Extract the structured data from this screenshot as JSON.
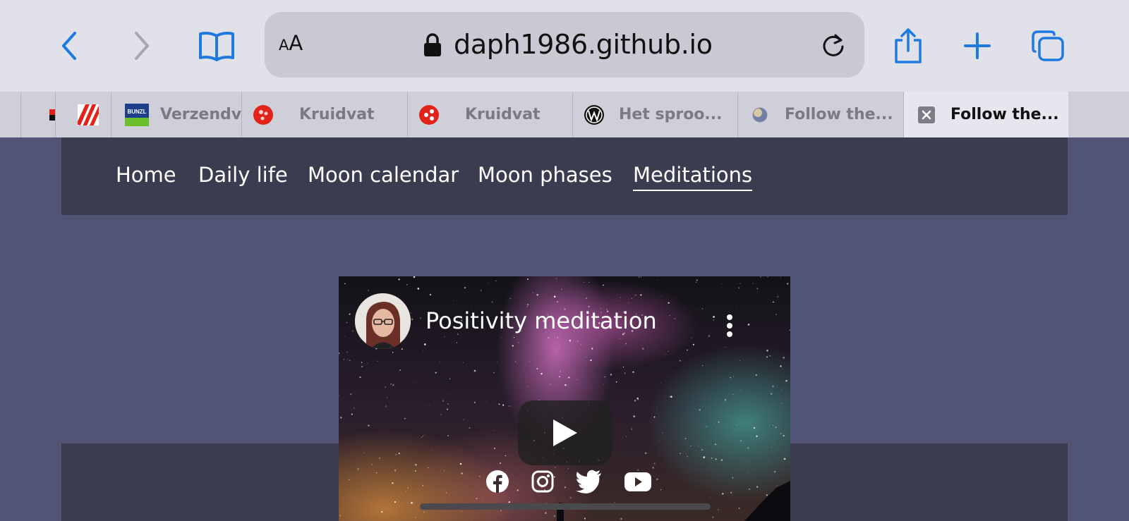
{
  "browser": {
    "text_size_small": "A",
    "text_size_large": "A",
    "url": "daph1986.github.io",
    "icons": [
      "back-icon",
      "forward-icon",
      "bookmarks-icon",
      "lock-icon",
      "reload-icon",
      "share-icon",
      "plus-icon",
      "tabs-icon"
    ],
    "accent": "#1f7ae0"
  },
  "tabs": [
    {
      "label": "",
      "favicon": "red-black-favicon"
    },
    {
      "label": "",
      "favicon": "red-stripes-favicon"
    },
    {
      "label": "Verzendve",
      "favicon": "bunzl-favicon"
    },
    {
      "label": "Kruidvat",
      "favicon": "kruidvat-favicon"
    },
    {
      "label": "Kruidvat",
      "favicon": "kruidvat-favicon"
    },
    {
      "label": "Het sproo...",
      "favicon": "w-favicon"
    },
    {
      "label": "Follow the...",
      "favicon": "moon-favicon"
    },
    {
      "label": "Follow the...",
      "favicon": "close-icon",
      "active": true
    }
  ],
  "nav": {
    "items": [
      "Home",
      "Daily life",
      "Moon calendar",
      "Moon phases",
      "Meditations"
    ],
    "active": "Meditations"
  },
  "video": {
    "title": "Positivity meditation",
    "icons": [
      "avatar",
      "more-vert-icon",
      "play-icon",
      "facebook-icon",
      "instagram-icon",
      "twitter-icon",
      "youtube-icon"
    ]
  },
  "colors": {
    "page_bg": "#525476",
    "nav_bg": "#3c3c51",
    "toolbar_bg": "#e1e1ea",
    "tabbar_bg": "#cfcfd9"
  }
}
